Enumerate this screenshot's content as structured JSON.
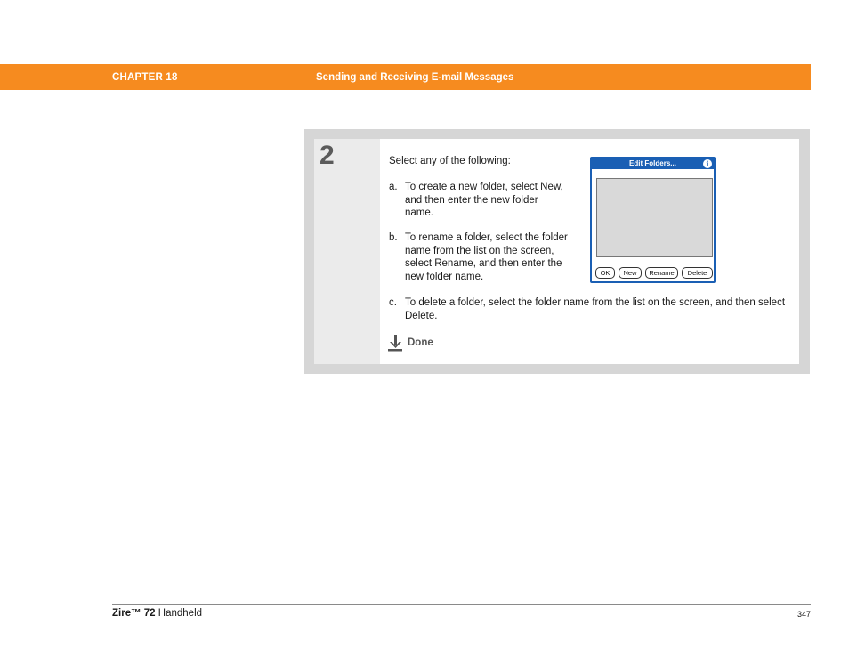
{
  "header": {
    "chapter": "CHAPTER 18",
    "title": "Sending and Receiving E-mail Messages",
    "accent_color": "#f68b1f"
  },
  "step": {
    "number": "2",
    "intro": "Select any of the following:",
    "items": [
      {
        "letter": "a.",
        "text": "To create a new folder, select New, and then enter the new folder name."
      },
      {
        "letter": "b.",
        "text": "To rename a folder, select the folder name from the list on the screen, select Rename, and then enter the new folder name."
      },
      {
        "letter": "c.",
        "text": "To delete a folder, select the folder name from the list on the screen, and then select Delete."
      }
    ],
    "done_icon": "down-arrow-icon",
    "done_label": "Done"
  },
  "dialog": {
    "title": "Edit Folders...",
    "info_icon": "i",
    "buttons": [
      "OK",
      "New",
      "Rename",
      "Delete"
    ],
    "accent_color": "#1a5fb4"
  },
  "footer": {
    "product_brand": "Zire™ 72",
    "product_suffix": "Handheld",
    "page_number": "347"
  }
}
